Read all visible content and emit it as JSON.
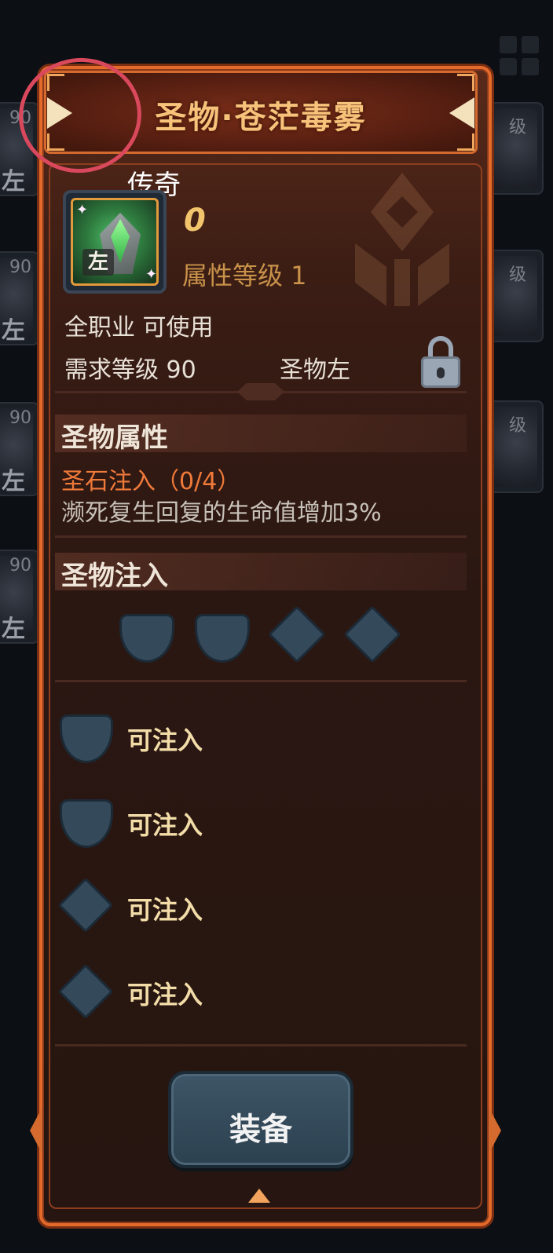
{
  "background": {
    "slots": [
      {
        "level": "90",
        "side": "左"
      },
      {
        "level": "90",
        "side": "左"
      },
      {
        "level": "90",
        "side": "左"
      },
      {
        "level": "90",
        "side": "左"
      }
    ],
    "right_slots": [
      {
        "level": "级"
      },
      {
        "level": "级"
      },
      {
        "level": "级"
      }
    ]
  },
  "panel": {
    "title": "圣物·苍茫毒雾",
    "rarity": "传奇",
    "item": {
      "side_tag": "左",
      "enhance_level": "0",
      "attribute_level": "属性等级 1",
      "job": "全职业 可使用",
      "required_level": "需求等级 90",
      "slot_type": "圣物左",
      "locked": true
    },
    "relic_attributes": {
      "title": "圣物属性",
      "infusion_stat": "圣石注入（0/4）",
      "infusion_desc": "濒死复生回复的生命值增加3%"
    },
    "relic_infusion": {
      "title": "圣物注入",
      "sockets": [
        "shield",
        "shield",
        "diamond",
        "diamond"
      ],
      "slots": [
        {
          "shape": "shield",
          "label": "可注入"
        },
        {
          "shape": "shield",
          "label": "可注入"
        },
        {
          "shape": "diamond",
          "label": "可注入"
        },
        {
          "shape": "diamond",
          "label": "可注入"
        }
      ]
    },
    "equip_button": "装备"
  },
  "colors": {
    "frame_orange": "#e36a2a",
    "title_gold": "#f7c27a",
    "infusion_orange": "#f07a3a",
    "socket_blue": "#34495a",
    "annotation_red": "#d9485c"
  }
}
